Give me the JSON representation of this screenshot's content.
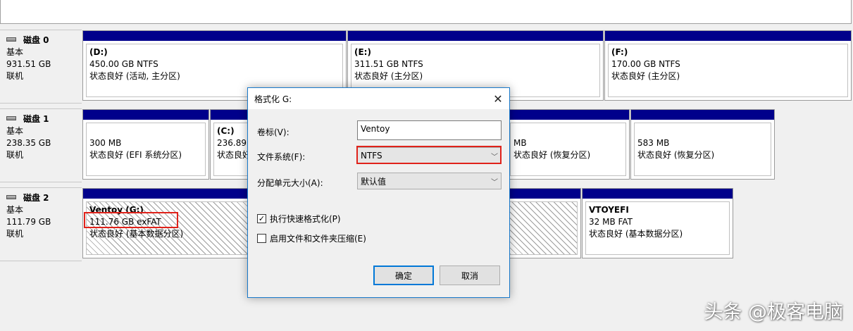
{
  "disks": [
    {
      "name": "磁盘 0",
      "type": "基本",
      "size": "931.51 GB",
      "status": "联机"
    },
    {
      "name": "磁盘 1",
      "type": "基本",
      "size": "238.35 GB",
      "status": "联机"
    },
    {
      "name": "磁盘 2",
      "type": "基本",
      "size": "111.79 GB",
      "status": "联机"
    }
  ],
  "partitions": {
    "d": {
      "name": "(D:)",
      "size": "450.00 GB NTFS",
      "status": "状态良好 (活动, 主分区)"
    },
    "e": {
      "name": "(E:)",
      "size": "311.51 GB NTFS",
      "status": "状态良好 (主分区)"
    },
    "f": {
      "name": "(F:)",
      "size": "170.00 GB NTFS",
      "status": "状态良好 (主分区)"
    },
    "efi": {
      "size": "300 MB",
      "status": "状态良好 (EFI 系统分区)"
    },
    "c": {
      "name": "(C:)",
      "size": "236.89",
      "status": "状态良好"
    },
    "rec1": {
      "size": "MB",
      "status": "状态良好 (恢复分区)"
    },
    "rec2": {
      "size": "583 MB",
      "status": "状态良好 (恢复分区)"
    },
    "g": {
      "name": "Ventoy  (G:)",
      "size": "111.76 GB exFAT",
      "status": "状态良好 (基本数据分区)"
    },
    "vtoy": {
      "name": "VTOYEFI",
      "size": "32 MB FAT",
      "status": "状态良好 (基本数据分区)"
    }
  },
  "dialog": {
    "title": "格式化 G:",
    "volume_label": "卷标(V):",
    "volume_value": "Ventoy",
    "fs_label": "文件系统(F):",
    "fs_value": "NTFS",
    "alloc_label": "分配单元大小(A):",
    "alloc_value": "默认值",
    "quick_format": "执行快速格式化(P)",
    "quick_format_checked": true,
    "compression": "启用文件和文件夹压缩(E)",
    "compression_checked": false,
    "ok": "确定",
    "cancel": "取消",
    "close_glyph": "✕"
  },
  "watermark": "头条 @极客电脑",
  "colors": {
    "partition_bar": "#00008b",
    "highlight": "#e0221a",
    "dialog_border": "#1979ca"
  }
}
